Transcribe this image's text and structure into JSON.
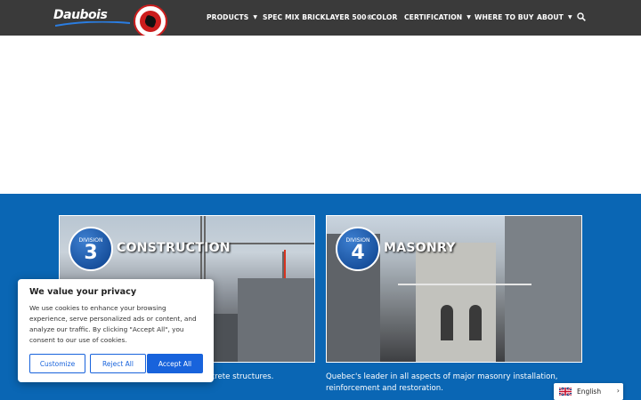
{
  "header": {
    "logo_text": "Daubois",
    "nav": [
      {
        "label": "PRODUCTS",
        "has_dropdown": true
      },
      {
        "label": "SPEC MIX BRICKLAYER 500®",
        "has_dropdown": false
      },
      {
        "label": "COLOR",
        "has_dropdown": false
      },
      {
        "label": "CERTIFICATION",
        "has_dropdown": true
      },
      {
        "label": "WHERE TO BUY",
        "has_dropdown": false
      },
      {
        "label": "ABOUT",
        "has_dropdown": true
      }
    ],
    "caret": "▼"
  },
  "cards": [
    {
      "division_label": "DIVISION",
      "division_number": "3",
      "title": "CONSTRUCTION",
      "description": "ed in the construction and repair of concrete structures."
    },
    {
      "division_label": "DIVISION",
      "division_number": "4",
      "title": "MASONRY",
      "description": "Quebec's leader in all aspects of major masonry installation, reinforcement and restoration."
    }
  ],
  "cookie": {
    "title": "We value your privacy",
    "text": "We use cookies to enhance your browsing experience, serve personalized ads or content, and analyze our traffic. By clicking \"Accept All\", you consent to our use of cookies.",
    "customize": "Customize",
    "reject": "Reject All",
    "accept": "Accept All"
  },
  "language": {
    "label": "English",
    "chevron": "›"
  },
  "colors": {
    "header_bg": "#3a3a3a",
    "section_bg": "#0a66b4",
    "accent": "#1863dc"
  }
}
